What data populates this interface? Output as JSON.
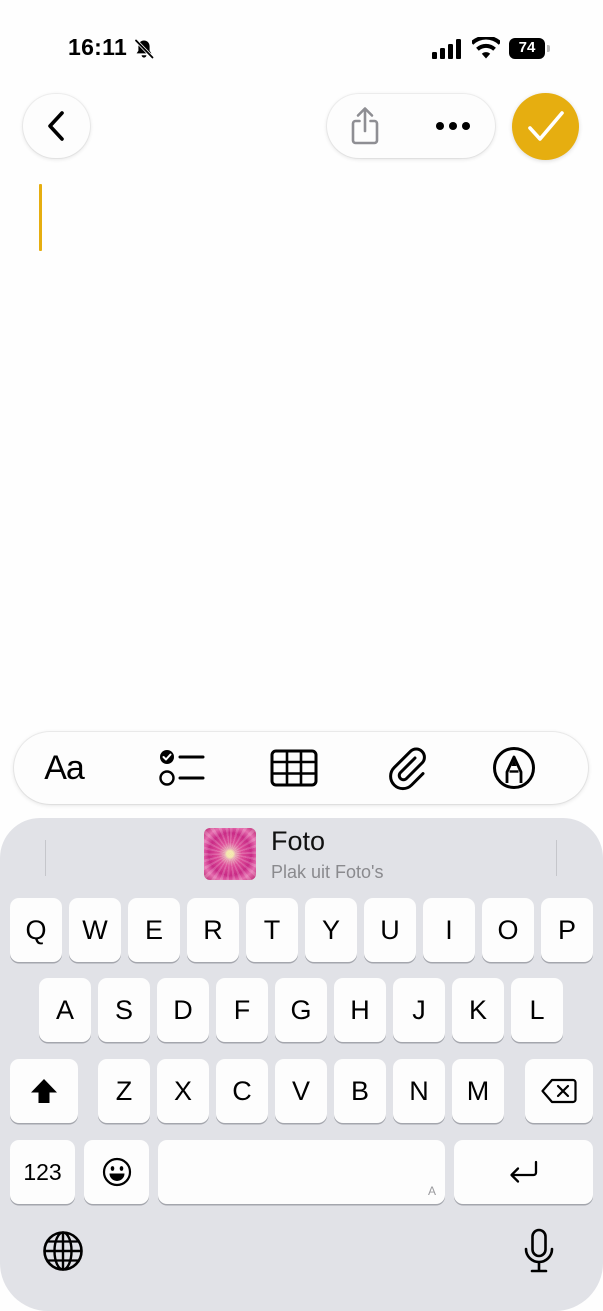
{
  "status_bar": {
    "time": "16:11",
    "battery_percent": "74",
    "silent_mode_icon": "bell-slash-icon",
    "signal_icon": "cellular-signal-icon",
    "wifi_icon": "wifi-icon"
  },
  "nav": {
    "back_icon": "chevron-left-icon",
    "share_icon": "share-icon",
    "more_icon": "ellipsis-icon",
    "done_icon": "checkmark-icon",
    "accent_color": "#e6ae10"
  },
  "note": {
    "content": ""
  },
  "toolbar": {
    "format_label": "Aa",
    "checklist_icon": "checklist-icon",
    "table_icon": "table-icon",
    "attachment_icon": "paperclip-icon",
    "markup_icon": "pen-tip-circle-icon"
  },
  "suggestion": {
    "title": "Foto",
    "subtitle": "Plak uit Foto's"
  },
  "keyboard": {
    "row1": [
      "Q",
      "W",
      "E",
      "R",
      "T",
      "Y",
      "U",
      "I",
      "O",
      "P"
    ],
    "row2": [
      "A",
      "S",
      "D",
      "F",
      "G",
      "H",
      "J",
      "K",
      "L"
    ],
    "row3": [
      "Z",
      "X",
      "C",
      "V",
      "B",
      "N",
      "M"
    ],
    "numbers_label": "123",
    "space_hint": "A",
    "shift_icon": "shift-icon",
    "delete_icon": "delete-backward-icon",
    "emoji_icon": "emoji-icon",
    "return_icon": "return-icon",
    "globe_icon": "globe-icon",
    "mic_icon": "microphone-icon"
  }
}
